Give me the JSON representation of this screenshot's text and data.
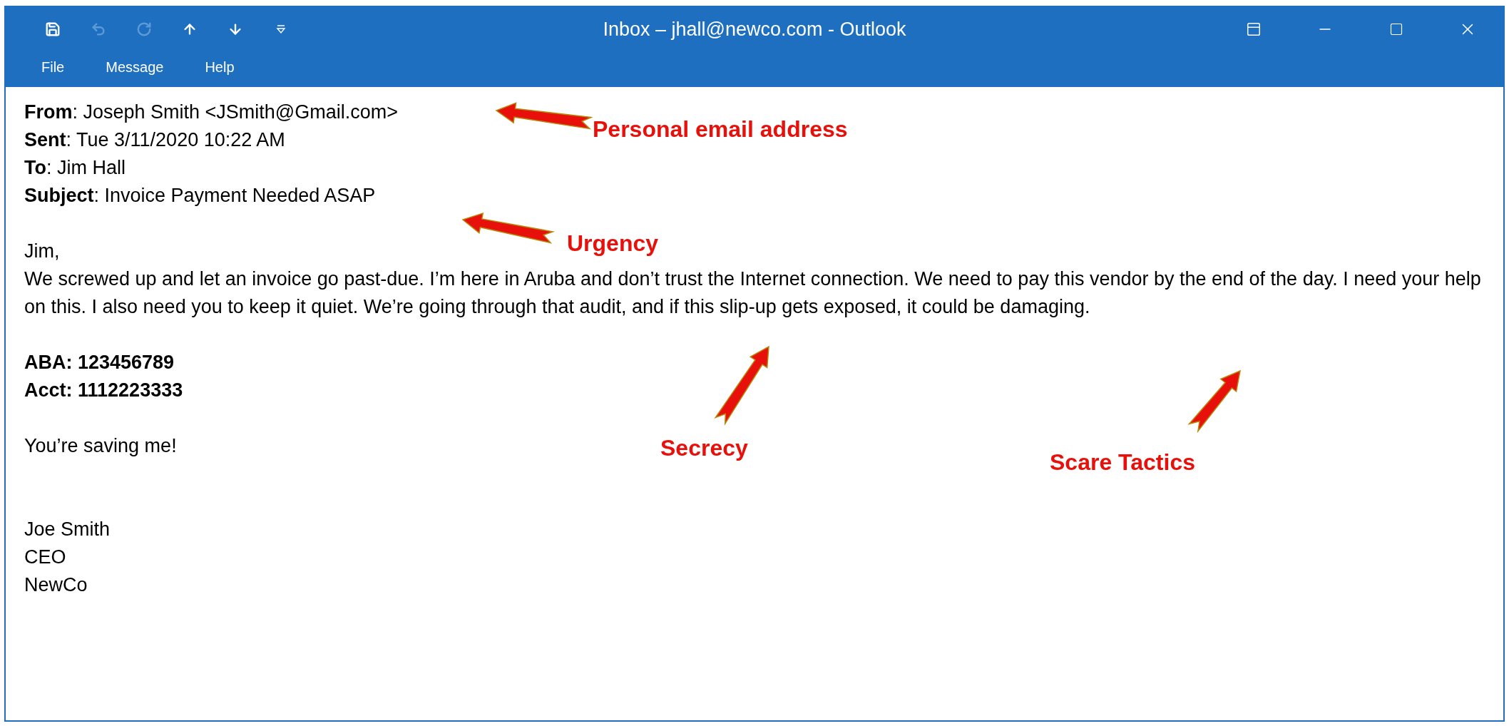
{
  "window": {
    "title": "Inbox – jhall@newco.com - Outlook"
  },
  "quick_access": [
    {
      "kind": "save",
      "disabled": false
    },
    {
      "kind": "undo",
      "disabled": true
    },
    {
      "kind": "redo",
      "disabled": true
    },
    {
      "kind": "up",
      "disabled": false
    },
    {
      "kind": "down",
      "disabled": false
    },
    {
      "kind": "customize",
      "disabled": false
    }
  ],
  "menu": [
    "File",
    "Message",
    "Help"
  ],
  "email": {
    "headers": [
      "**From**: Joseph Smith <JSmith@Gmail.com>",
      "**Sent**: Tue 3/11/2020 10:22 AM",
      "**To**: Jim Hall",
      "**Subject**: Invoice Payment Needed ASAP"
    ],
    "blocks": [
      {
        "kind": "text",
        "bold": false,
        "lines": [
          "Jim,",
          "We screwed up and let an invoice go past-due. I’m here in Aruba and don’t trust the Internet connection. We need to pay this vendor by the end of the day. I need your help on this. I also need you to keep it quiet. We’re going through that audit, and if this slip-up gets exposed, it could be damaging."
        ]
      },
      {
        "kind": "text",
        "bold": true,
        "lines": [
          "ABA: 123456789",
          "Acct: 1112223333"
        ]
      },
      {
        "kind": "text",
        "bold": false,
        "lines": [
          "You’re saving me!"
        ]
      },
      {
        "kind": "signature",
        "bold": false,
        "lines": [
          "Joe Smith",
          "CEO",
          "NewCo"
        ]
      }
    ]
  },
  "annotations": [
    {
      "label": "Personal email address"
    },
    {
      "label": "Urgency"
    },
    {
      "label": "Secrecy"
    },
    {
      "label": "Scare Tactics"
    }
  ]
}
